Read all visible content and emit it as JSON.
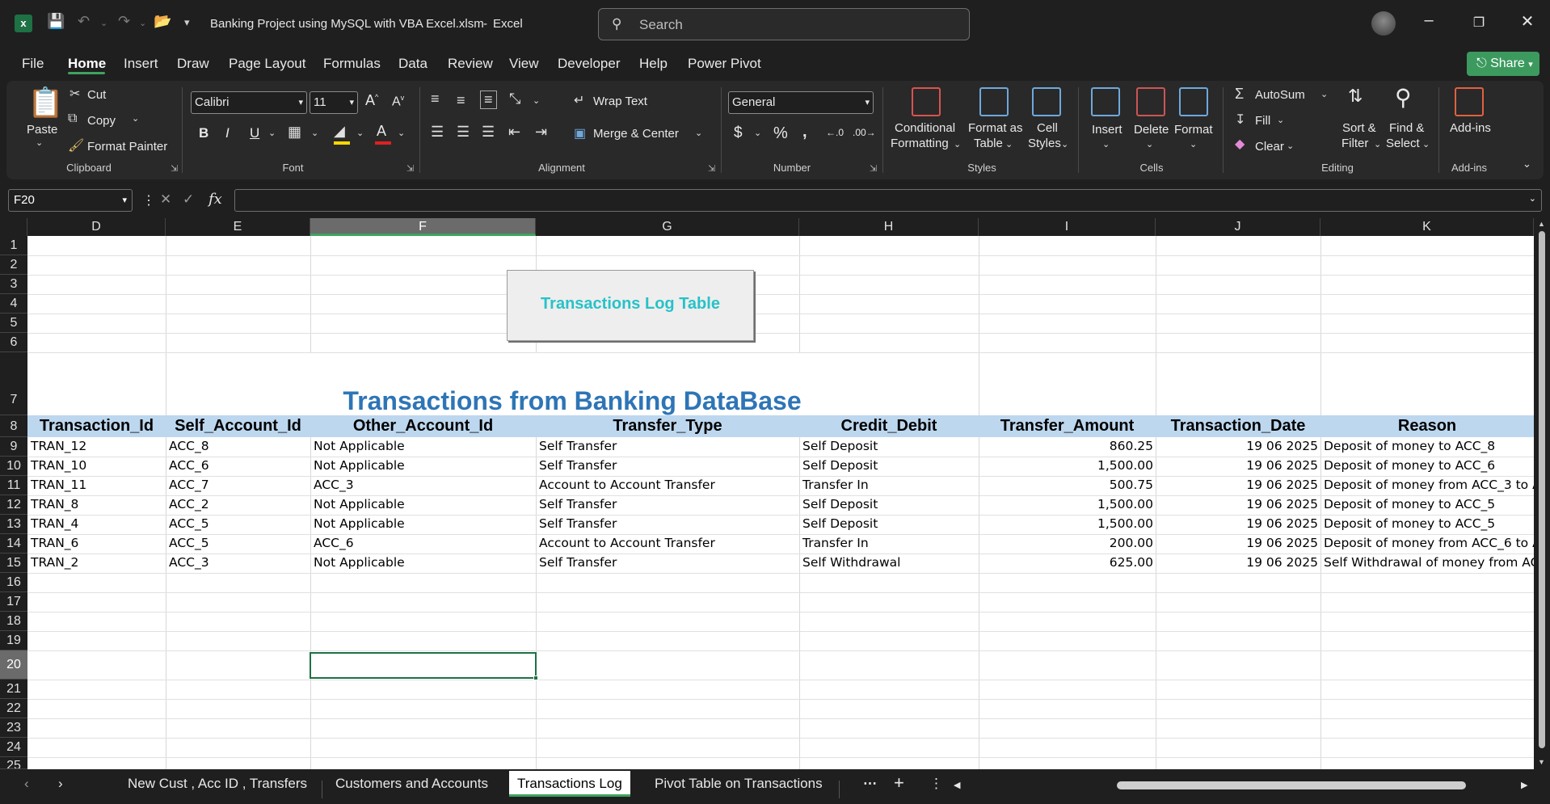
{
  "window": {
    "file_title": "Banking Project using MySQL with VBA Excel.xlsm",
    "app_name": "Excel",
    "search_placeholder": "Search"
  },
  "menu": [
    "File",
    "Home",
    "Insert",
    "Draw",
    "Page Layout",
    "Formulas",
    "Data",
    "Review",
    "View",
    "Developer",
    "Help",
    "Power Pivot"
  ],
  "share_label": "Share",
  "ribbon": {
    "clipboard": {
      "paste": "Paste",
      "cut": "Cut",
      "copy": "Copy",
      "format_painter": "Format Painter",
      "label": "Clipboard"
    },
    "font": {
      "name": "Calibri",
      "size": "11",
      "label": "Font",
      "bold": "B",
      "italic": "I",
      "underline": "U"
    },
    "alignment": {
      "wrap_text": "Wrap Text",
      "merge_center": "Merge & Center",
      "label": "Alignment"
    },
    "number": {
      "format": "General",
      "label": "Number"
    },
    "styles": {
      "conditional_1": "Conditional",
      "conditional_2": "Formatting",
      "format_table_1": "Format as",
      "format_table_2": "Table",
      "cell_styles_1": "Cell",
      "cell_styles_2": "Styles",
      "label": "Styles"
    },
    "cells": {
      "insert": "Insert",
      "delete": "Delete",
      "format": "Format",
      "label": "Cells"
    },
    "editing": {
      "autosum": "AutoSum",
      "fill": "Fill",
      "clear": "Clear",
      "sort_1": "Sort &",
      "sort_2": "Filter",
      "find_1": "Find &",
      "find_2": "Select",
      "label": "Editing"
    },
    "addins": {
      "addins": "Add-ins",
      "label": "Add-ins"
    }
  },
  "name_box": "F20",
  "columns": [
    "D",
    "E",
    "F",
    "G",
    "H",
    "I",
    "J",
    "K"
  ],
  "rows": [
    "1",
    "2",
    "3",
    "4",
    "5",
    "6",
    "7",
    "8",
    "9",
    "10",
    "11",
    "12",
    "13",
    "14",
    "15",
    "16",
    "17",
    "18",
    "19",
    "20",
    "21",
    "22",
    "23",
    "24",
    "25"
  ],
  "shape_button": "Transactions Log Table",
  "banner": "Transactions from Banking DataBase",
  "table": {
    "headers": [
      "Transaction_Id",
      "Self_Account_Id",
      "Other_Account_Id",
      "Transfer_Type",
      "Credit_Debit",
      "Transfer_Amount",
      "Transaction_Date",
      "Reason"
    ],
    "rows": [
      [
        "TRAN_12",
        "ACC_8",
        "Not Applicable",
        "Self Transfer",
        "Self Deposit",
        "860.25",
        "19 06 2025",
        "Deposit of money to ACC_8"
      ],
      [
        "TRAN_10",
        "ACC_6",
        "Not Applicable",
        "Self Transfer",
        "Self Deposit",
        "1,500.00",
        "19 06 2025",
        "Deposit of money to ACC_6"
      ],
      [
        "TRAN_11",
        "ACC_7",
        "ACC_3",
        "Account to Account Transfer",
        "Transfer In",
        "500.75",
        "19 06 2025",
        "Deposit of money from ACC_3 to A"
      ],
      [
        "TRAN_8",
        "ACC_2",
        "Not Applicable",
        "Self Transfer",
        "Self Deposit",
        "1,500.00",
        "19 06 2025",
        "Deposit of money to ACC_5"
      ],
      [
        "TRAN_4",
        "ACC_5",
        "Not Applicable",
        "Self Transfer",
        "Self Deposit",
        "1,500.00",
        "19 06 2025",
        "Deposit of money to ACC_5"
      ],
      [
        "TRAN_6",
        "ACC_5",
        "ACC_6",
        "Account to Account Transfer",
        "Transfer In",
        "200.00",
        "19 06 2025",
        "Deposit of money from ACC_6 to A"
      ],
      [
        "TRAN_2",
        "ACC_3",
        "Not Applicable",
        "Self Transfer",
        "Self Withdrawal",
        "625.00",
        "19 06 2025",
        "Self Withdrawal of money from AC"
      ]
    ]
  },
  "sheet_tabs": [
    "New Cust , Acc ID , Transfers",
    "Customers and Accounts",
    "Transactions Log",
    "Pivot Table on Transactions"
  ],
  "active_tab": "Transactions Log",
  "colors": {
    "accent_green": "#3ea35f",
    "header_band": "#bdd7ee",
    "banner_blue": "#2e75b6",
    "button_text": "#27c2c8"
  }
}
